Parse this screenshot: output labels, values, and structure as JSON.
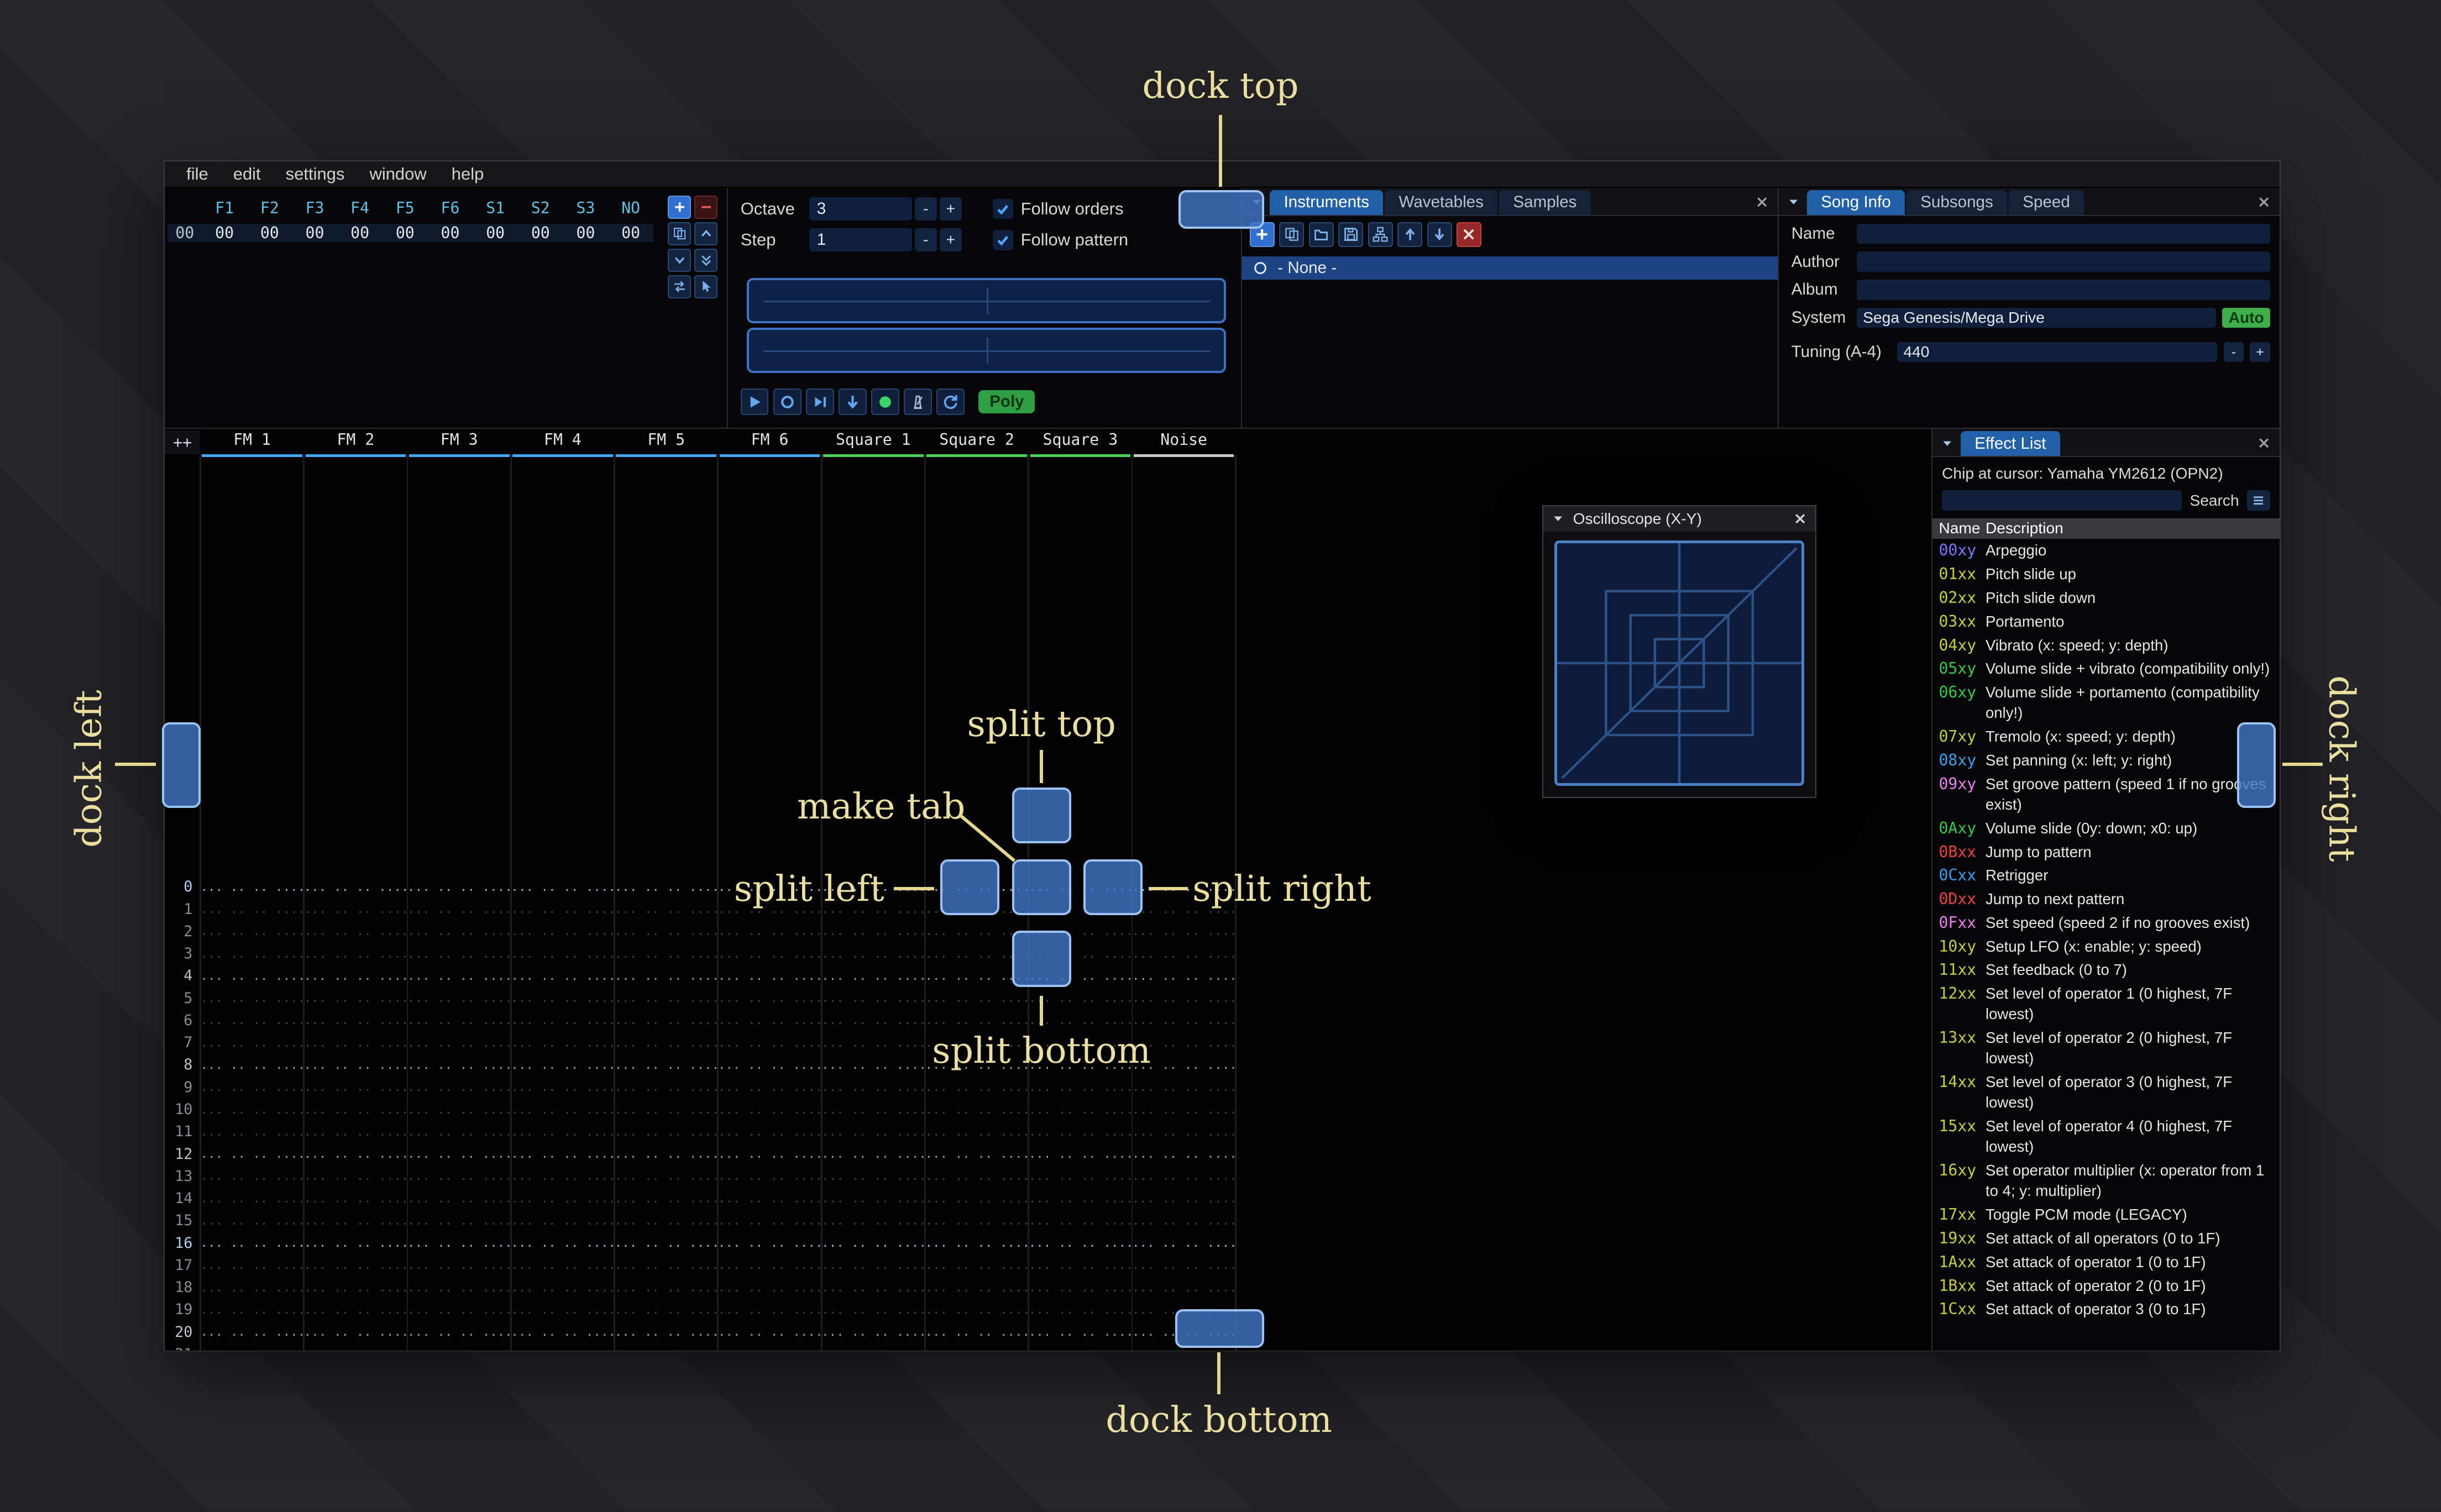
{
  "window": {
    "menu": [
      "file",
      "edit",
      "settings",
      "window",
      "help"
    ]
  },
  "order_list": {
    "row_index": "00",
    "channels": [
      "F1",
      "F2",
      "F3",
      "F4",
      "F5",
      "F6",
      "S1",
      "S2",
      "S3",
      "NO"
    ],
    "values": [
      "00",
      "00",
      "00",
      "00",
      "00",
      "00",
      "00",
      "00",
      "00",
      "00"
    ],
    "buttons": [
      {
        "icon": "plus",
        "style": "blue",
        "name": "order-add"
      },
      {
        "icon": "minus",
        "style": "red",
        "name": "order-remove"
      },
      {
        "icon": "copy",
        "style": "",
        "name": "order-duplicate"
      },
      {
        "icon": "chev-up",
        "style": "",
        "name": "order-move-up"
      },
      {
        "icon": "chev-down",
        "style": "",
        "name": "order-move-down"
      },
      {
        "icon": "chev-double-down",
        "style": "",
        "name": "order-duplicate-end"
      },
      {
        "icon": "swap",
        "style": "",
        "name": "order-change-mode"
      },
      {
        "icon": "pointer",
        "style": "",
        "name": "order-edit-mode"
      }
    ]
  },
  "transport": {
    "octave_label": "Octave",
    "octave_value": "3",
    "step_label": "Step",
    "step_value": "1",
    "minus_label": "-",
    "plus_label": "+",
    "follow_orders": "Follow orders",
    "follow_pattern": "Follow pattern",
    "poly_label": "Poly",
    "buttons": [
      {
        "icon": "play",
        "style": "",
        "name": "play"
      },
      {
        "icon": "circle",
        "style": "",
        "name": "play-repeat"
      },
      {
        "icon": "step-forward",
        "style": "",
        "name": "step-one-row"
      },
      {
        "icon": "arrow-down",
        "style": "",
        "name": "move-cursor-down"
      },
      {
        "icon": "dot",
        "style": "green",
        "name": "edit-toggle"
      },
      {
        "icon": "metronome",
        "style": "metro",
        "name": "metronome"
      },
      {
        "icon": "repeat",
        "style": "",
        "name": "repeat-pattern"
      }
    ]
  },
  "assets": {
    "tabs": [
      {
        "label": "Instruments",
        "active": true
      },
      {
        "label": "Wavetables",
        "active": false
      },
      {
        "label": "Samples",
        "active": false
      }
    ],
    "toolbar": [
      {
        "icon": "plus",
        "style": "blue",
        "name": "instrument-add"
      },
      {
        "icon": "copy",
        "style": "",
        "name": "instrument-duplicate"
      },
      {
        "icon": "folder",
        "style": "",
        "name": "instrument-open"
      },
      {
        "icon": "save",
        "style": "",
        "name": "instrument-save"
      },
      {
        "icon": "tree",
        "style": "",
        "name": "instrument-toggle-folders"
      },
      {
        "icon": "arrow-up",
        "style": "",
        "name": "instrument-move-up"
      },
      {
        "icon": "arrow-down",
        "style": "",
        "name": "instrument-move-down"
      },
      {
        "icon": "close",
        "style": "del",
        "name": "instrument-delete"
      }
    ],
    "list_label": "- None -"
  },
  "song_info": {
    "tabs": [
      {
        "label": "Song Info",
        "active": true
      },
      {
        "label": "Subsongs",
        "active": false
      },
      {
        "label": "Speed",
        "active": false
      }
    ],
    "name_label": "Name",
    "name_value": "",
    "author_label": "Author",
    "author_value": "",
    "album_label": "Album",
    "album_value": "",
    "system_label": "System",
    "system_value": "Sega Genesis/Mega Drive",
    "auto_label": "Auto",
    "tuning_label": "Tuning (A-4)",
    "tuning_value": "440",
    "minus_label": "-",
    "plus_label": "+"
  },
  "pattern": {
    "corner_label": "++",
    "row_count": 22,
    "empty_cell": "... .. .. ....",
    "channels": [
      {
        "name": "FM 1",
        "color": "#3fa8f5"
      },
      {
        "name": "FM 2",
        "color": "#3fa8f5"
      },
      {
        "name": "FM 3",
        "color": "#3fa8f5"
      },
      {
        "name": "FM 4",
        "color": "#3fa8f5"
      },
      {
        "name": "FM 5",
        "color": "#3fa8f5"
      },
      {
        "name": "FM 6",
        "color": "#3fa8f5"
      },
      {
        "name": "Square 1",
        "color": "#45d35a"
      },
      {
        "name": "Square 2",
        "color": "#45d35a"
      },
      {
        "name": "Square 3",
        "color": "#45d35a"
      },
      {
        "name": "Noise",
        "color": "#c8c8c8"
      }
    ]
  },
  "oscilloscope": {
    "title": "Oscilloscope (X-Y)"
  },
  "effect_list": {
    "tabs": [
      {
        "label": "Effect List",
        "active": true
      }
    ],
    "chip_text": "Chip at cursor: Yamaha YM2612 (OPN2)",
    "search_label": "Search",
    "name_col": "Name",
    "desc_col": "Description",
    "effects": [
      {
        "code": "00xy",
        "desc": "Arpeggio",
        "color": "#7878ff"
      },
      {
        "code": "01xx",
        "desc": "Pitch slide up",
        "color": "#c9cf36"
      },
      {
        "code": "02xx",
        "desc": "Pitch slide down",
        "color": "#c9cf36"
      },
      {
        "code": "03xx",
        "desc": "Portamento",
        "color": "#c9cf36"
      },
      {
        "code": "04xy",
        "desc": "Vibrato (x: speed; y: depth)",
        "color": "#c9cf36"
      },
      {
        "code": "05xy",
        "desc": "Volume slide + vibrato (compatibility only!)",
        "color": "#2ecc47"
      },
      {
        "code": "06xy",
        "desc": "Volume slide + portamento (compatibility only!)",
        "color": "#2ecc47"
      },
      {
        "code": "07xy",
        "desc": "Tremolo (x: speed; y: depth)",
        "color": "#c9cf36"
      },
      {
        "code": "08xy",
        "desc": "Set panning (x: left; y: right)",
        "color": "#35a2f0"
      },
      {
        "code": "09xy",
        "desc": "Set groove pattern (speed 1 if no grooves exist)",
        "color": "#ef7ff0"
      },
      {
        "code": "0Axy",
        "desc": "Volume slide (0y: down; x0: up)",
        "color": "#2ecc47"
      },
      {
        "code": "0Bxx",
        "desc": "Jump to pattern",
        "color": "#f24040"
      },
      {
        "code": "0Cxx",
        "desc": "Retrigger",
        "color": "#35a2f0"
      },
      {
        "code": "0Dxx",
        "desc": "Jump to next pattern",
        "color": "#f24040"
      },
      {
        "code": "0Fxx",
        "desc": "Set speed (speed 2 if no grooves exist)",
        "color": "#ef7ff0"
      },
      {
        "code": "10xy",
        "desc": "Setup LFO (x: enable; y: speed)",
        "color": "#c9cf36"
      },
      {
        "code": "11xx",
        "desc": "Set feedback (0 to 7)",
        "color": "#c9cf36"
      },
      {
        "code": "12xx",
        "desc": "Set level of operator 1 (0 highest, 7F lowest)",
        "color": "#c9cf36"
      },
      {
        "code": "13xx",
        "desc": "Set level of operator 2 (0 highest, 7F lowest)",
        "color": "#c9cf36"
      },
      {
        "code": "14xx",
        "desc": "Set level of operator 3 (0 highest, 7F lowest)",
        "color": "#c9cf36"
      },
      {
        "code": "15xx",
        "desc": "Set level of operator 4 (0 highest, 7F lowest)",
        "color": "#c9cf36"
      },
      {
        "code": "16xy",
        "desc": "Set operator multiplier (x: operator from 1 to 4; y: multiplier)",
        "color": "#c9cf36"
      },
      {
        "code": "17xx",
        "desc": "Toggle PCM mode (LEGACY)",
        "color": "#c9cf36"
      },
      {
        "code": "19xx",
        "desc": "Set attack of all operators (0 to 1F)",
        "color": "#c9cf36"
      },
      {
        "code": "1Axx",
        "desc": "Set attack of operator 1 (0 to 1F)",
        "color": "#c9cf36"
      },
      {
        "code": "1Bxx",
        "desc": "Set attack of operator 2 (0 to 1F)",
        "color": "#c9cf36"
      },
      {
        "code": "1Cxx",
        "desc": "Set attack of operator 3 (0 to 1F)",
        "color": "#c9cf36"
      }
    ]
  },
  "overlay": {
    "labels": {
      "dock_top": "dock top",
      "dock_bottom": "dock bottom",
      "dock_left": "dock left",
      "dock_right": "dock right",
      "split_top": "split top",
      "split_bottom": "split bottom",
      "split_left": "split left",
      "split_right": "split right",
      "make_tab": "make tab"
    }
  }
}
